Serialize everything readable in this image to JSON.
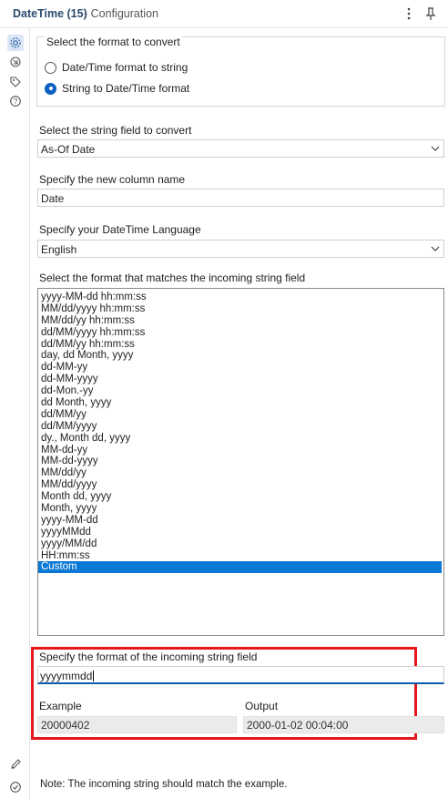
{
  "header": {
    "title": "DateTime (15)",
    "subtitle": "- Configuration"
  },
  "rail": {
    "icons": [
      "gear-icon",
      "connection-icon",
      "tag-icon",
      "help-icon"
    ],
    "bottom_icons": [
      "pencil-icon",
      "check-circle-icon"
    ]
  },
  "convert": {
    "legend": "Select the format to convert",
    "options": [
      "Date/Time format to string",
      "String to Date/Time format"
    ],
    "selected_index": 1
  },
  "field": {
    "label": "Select the string field to convert",
    "value": "As-Of Date"
  },
  "column": {
    "label": "Specify the new column name",
    "value": "Date"
  },
  "language": {
    "label": "Specify your DateTime Language",
    "value": "English"
  },
  "formats": {
    "label": "Select the format that matches the incoming string field",
    "items": [
      "yyyy-MM-dd hh:mm:ss",
      "MM/dd/yyyy hh:mm:ss",
      "MM/dd/yy hh:mm:ss",
      "dd/MM/yyyy hh:mm:ss",
      "dd/MM/yy hh:mm:ss",
      "day, dd Month, yyyy",
      "dd-MM-yy",
      "dd-MM-yyyy",
      "dd-Mon.-yy",
      "dd Month, yyyy",
      "dd/MM/yy",
      "dd/MM/yyyy",
      "dy., Month dd, yyyy",
      "MM-dd-yy",
      "MM-dd-yyyy",
      "MM/dd/yy",
      "MM/dd/yyyy",
      "Month dd, yyyy",
      "Month, yyyy",
      "yyyy-MM-dd",
      "yyyyMMdd",
      "yyyy/MM/dd",
      "HH:mm:ss",
      "Custom"
    ],
    "selected_index": 23
  },
  "custom": {
    "label": "Specify the format of the incoming string field",
    "value": "yyyymmdd"
  },
  "example": {
    "label": "Example",
    "value": "20000402"
  },
  "output": {
    "label": "Output",
    "value": "2000-01-02 00:04:00"
  },
  "note": "Note: The incoming string should match the example.",
  "colors": {
    "accent": "#0b62c4",
    "selection": "#0a78d7",
    "highlight": "#e5171d"
  }
}
